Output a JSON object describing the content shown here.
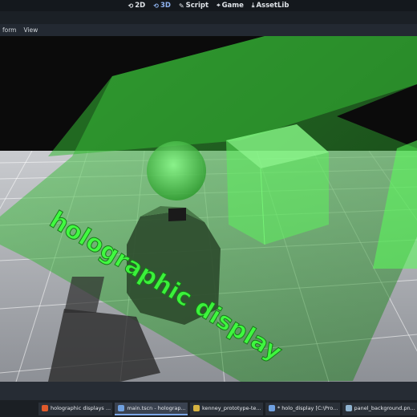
{
  "workspace_tabs": [
    {
      "glyph": "⟲",
      "label": "2D",
      "active": false
    },
    {
      "glyph": "⟲",
      "label": "3D",
      "active": true
    },
    {
      "glyph": "✎",
      "label": "Script",
      "active": false
    },
    {
      "glyph": "⌖",
      "label": "Game",
      "active": false
    },
    {
      "glyph": "⤓",
      "label": "AssetLib",
      "active": false
    }
  ],
  "menubar": {
    "transform": "form",
    "view": "View"
  },
  "scene": {
    "holo_text": "holographic display",
    "holo_color": "#3cff3c"
  },
  "taskbar": [
    {
      "label": "holographic displays ...",
      "icon_color": "#e05a2b",
      "active": false
    },
    {
      "label": "main.tscn - holograp...",
      "icon_color": "#6fa0e0",
      "active": true
    },
    {
      "label": "kenney_prototype-te...",
      "icon_color": "#d6b341",
      "active": false
    },
    {
      "label": "* holo_display [C:\\Pro...",
      "icon_color": "#6fa0e0",
      "active": false
    },
    {
      "label": "panel_background.pn...",
      "icon_color": "#8fb3d0",
      "active": false
    }
  ]
}
